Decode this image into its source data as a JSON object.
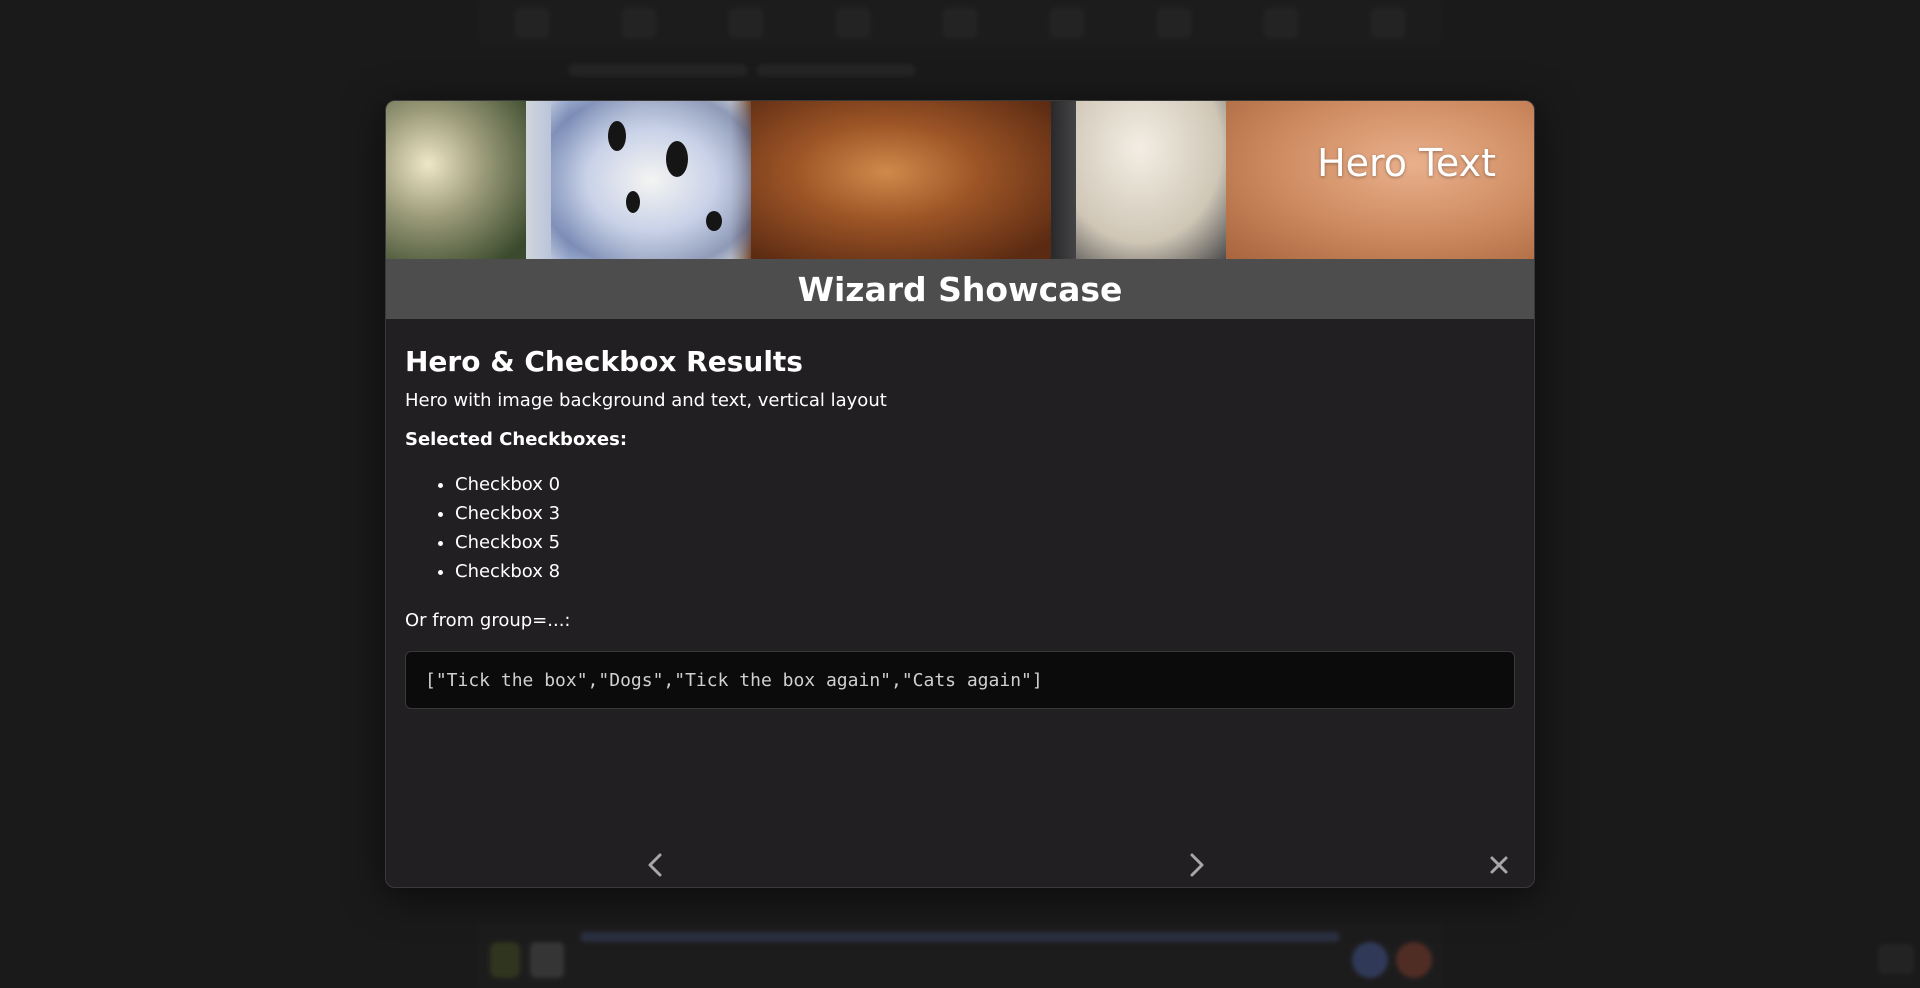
{
  "hero": {
    "text": "Hero Text"
  },
  "wizard": {
    "title": "Wizard Showcase"
  },
  "content": {
    "heading": "Hero & Checkbox Results",
    "description": "Hero with image background and text, vertical layout",
    "selected_label": "Selected Checkboxes:",
    "checkboxes": [
      "Checkbox 0",
      "Checkbox 3",
      "Checkbox 5",
      "Checkbox 8"
    ],
    "group_label": "Or from group=...:",
    "group_value": "[\"Tick the box\",\"Dogs\",\"Tick the box again\",\"Cats again\"]"
  },
  "nav": {
    "prev_icon": "chevron-left-icon",
    "next_icon": "chevron-right-icon",
    "close_icon": "close-icon"
  },
  "colors": {
    "modal_bg": "#211f21",
    "title_bar": "#4d4d4d",
    "code_bg": "#0b0b0b",
    "page_bg": "#1f1e1f"
  }
}
